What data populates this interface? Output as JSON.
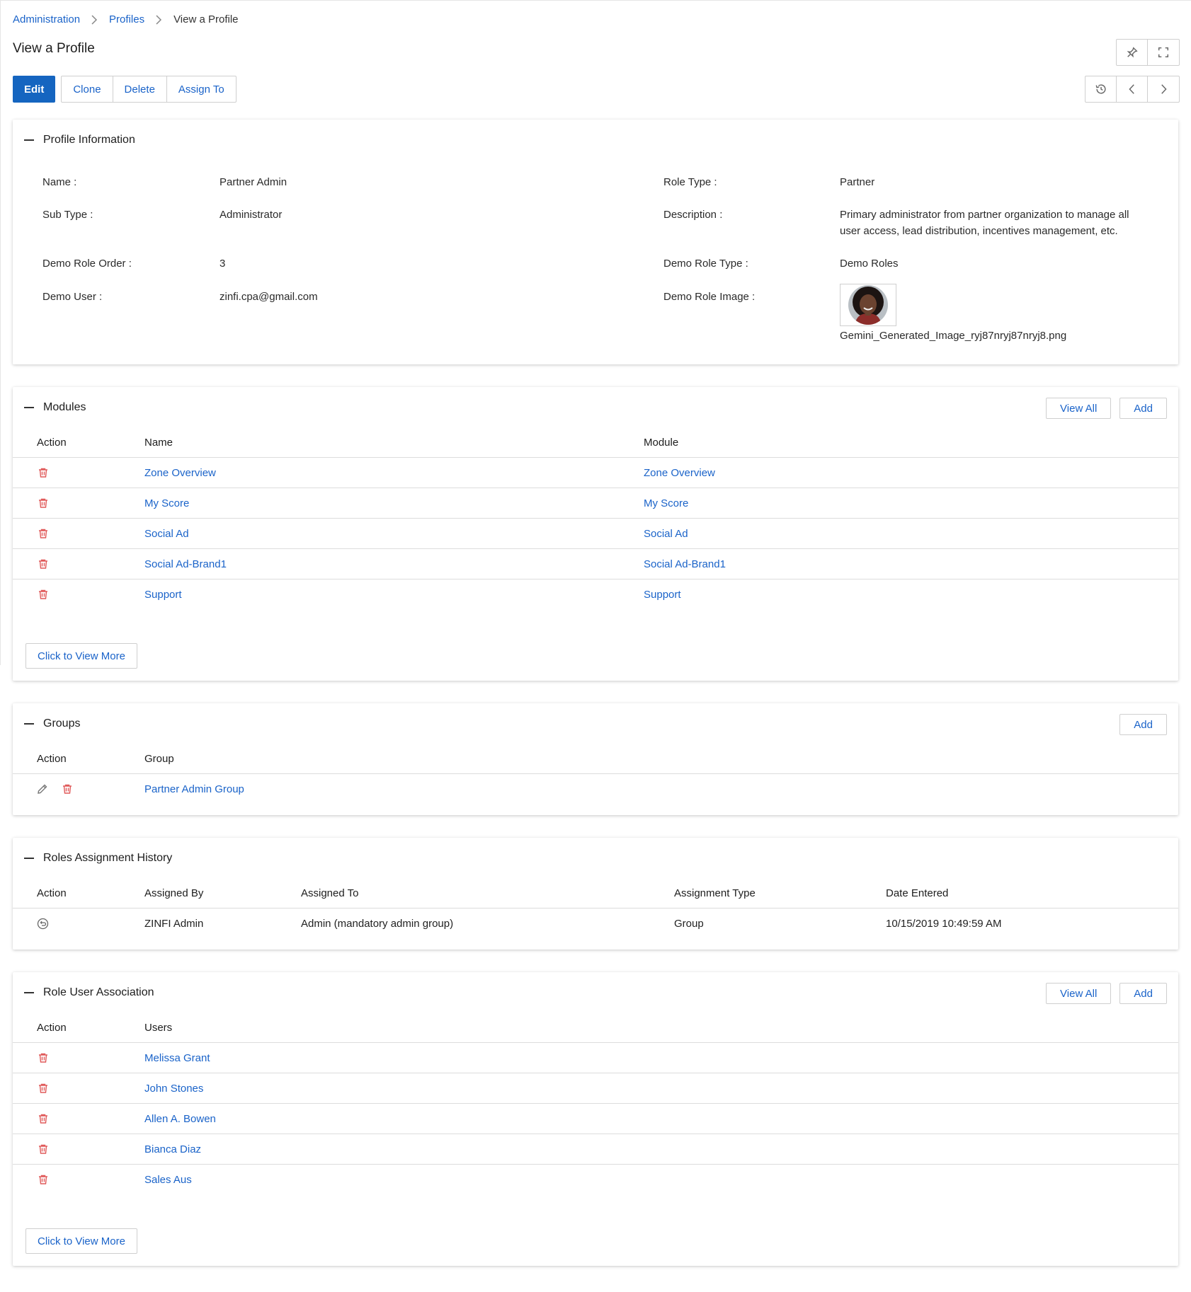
{
  "breadcrumb": {
    "items": [
      "Administration",
      "Profiles"
    ],
    "current": "View a Profile"
  },
  "page": {
    "title": "View a Profile"
  },
  "toolbar": {
    "edit_label": "Edit",
    "clone_label": "Clone",
    "delete_label": "Delete",
    "assign_label": "Assign To"
  },
  "profile_info": {
    "title": "Profile Information",
    "name_label": "Name :",
    "name_value": "Partner Admin",
    "role_type_label": "Role Type :",
    "role_type_value": "Partner",
    "sub_type_label": "Sub Type :",
    "sub_type_value": "Administrator",
    "description_label": "Description :",
    "description_line1": "Primary administrator from partner organization to manage all",
    "description_line2": "user access, lead distribution, incentives management, etc.",
    "demo_role_order_label": "Demo Role Order :",
    "demo_role_order_value": "3",
    "demo_role_type_label": "Demo Role Type :",
    "demo_role_type_value": "Demo Roles",
    "demo_user_label": "Demo User :",
    "demo_user_value": "zinfi.cpa@gmail.com",
    "demo_role_image_label": "Demo Role Image :",
    "demo_role_image_file": "Gemini_Generated_Image_ryj87nryj87nryj8.png"
  },
  "modules": {
    "title": "Modules",
    "view_all_label": "View All",
    "add_label": "Add",
    "headers": {
      "action": "Action",
      "name": "Name",
      "module": "Module"
    },
    "rows": [
      {
        "name": "Zone Overview",
        "module": "Zone Overview"
      },
      {
        "name": "My Score",
        "module": "My Score"
      },
      {
        "name": "Social Ad",
        "module": "Social Ad"
      },
      {
        "name": "Social Ad-Brand1",
        "module": "Social Ad-Brand1"
      },
      {
        "name": "Support",
        "module": "Support"
      }
    ],
    "more_label": "Click to View More"
  },
  "groups": {
    "title": "Groups",
    "add_label": "Add",
    "headers": {
      "action": "Action",
      "group": "Group"
    },
    "rows": [
      {
        "group": "Partner Admin Group"
      }
    ]
  },
  "history": {
    "title": "Roles Assignment History",
    "headers": {
      "action": "Action",
      "assigned_by": "Assigned By",
      "assigned_to": "Assigned To",
      "assignment_type": "Assignment Type",
      "date_entered": "Date Entered"
    },
    "rows": [
      {
        "assigned_by": "ZINFI Admin",
        "assigned_to": "Admin (mandatory admin group)",
        "assignment_type": "Group",
        "date_entered": "10/15/2019 10:49:59 AM"
      }
    ]
  },
  "users": {
    "title": "Role User Association",
    "view_all_label": "View All",
    "add_label": "Add",
    "headers": {
      "action": "Action",
      "users": "Users"
    },
    "rows": [
      {
        "user": "Melissa Grant"
      },
      {
        "user": "John Stones"
      },
      {
        "user": "Allen A. Bowen"
      },
      {
        "user": "Bianca Diaz"
      },
      {
        "user": "Sales Aus"
      }
    ],
    "more_label": "Click to View More"
  },
  "colors": {
    "accent": "#1565c0",
    "link": "#1a63c9",
    "danger": "#e05a5a"
  },
  "icons": [
    "chevron-right-icon",
    "pin-icon",
    "fullscreen-icon",
    "history-icon",
    "chevron-left-icon",
    "trash-icon",
    "pencil-icon",
    "restore-icon"
  ]
}
